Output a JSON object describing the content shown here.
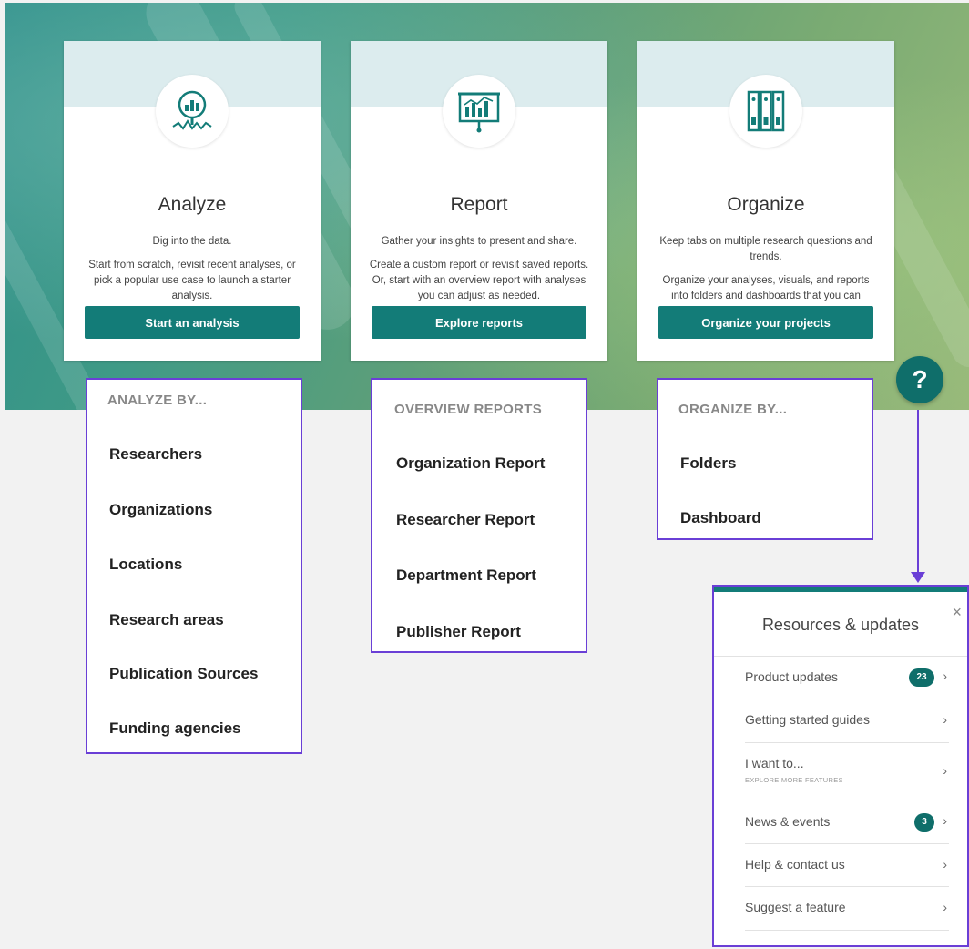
{
  "cards": [
    {
      "icon": "analyze-magnifier-chart-icon",
      "title": "Analyze",
      "desc1": "Dig into the data.",
      "desc2": "Start from scratch, revisit recent analyses, or pick a popular use case to launch a starter analysis.",
      "button": "Start an analysis"
    },
    {
      "icon": "report-presentation-board-icon",
      "title": "Report",
      "desc1": "Gather your insights to present and share.",
      "desc2": "Create a custom report or revisit saved reports. Or, start with an overview report with analyses you can adjust as needed.",
      "button": "Explore reports"
    },
    {
      "icon": "organize-binders-icon",
      "title": "Organize",
      "desc1": "Keep tabs on multiple research questions and trends.",
      "desc2": "Organize your analyses, visuals, and reports into folders and dashboards that you can revisit.",
      "button": "Organize your projects"
    }
  ],
  "help": {
    "label": "?",
    "icon": "help-question-icon"
  },
  "analyze_menu": {
    "header": "ANALYZE BY...",
    "items": [
      "Researchers",
      "Organizations",
      "Locations",
      "Research areas",
      "Publication Sources",
      "Funding agencies"
    ]
  },
  "report_menu": {
    "header": "OVERVIEW REPORTS",
    "items": [
      "Organization Report",
      "Researcher Report",
      "Department Report",
      "Publisher Report"
    ]
  },
  "organize_menu": {
    "header": "ORGANIZE BY...",
    "items": [
      "Folders",
      "Dashboard"
    ]
  },
  "panel": {
    "title": "Resources & updates",
    "close": "×",
    "rows": [
      {
        "label": "Product updates",
        "badge": "23"
      },
      {
        "label": "Getting started guides"
      },
      {
        "label": "I want to...",
        "sub": "EXPLORE MORE FEATURES"
      },
      {
        "label": "News & events",
        "badge": "3"
      },
      {
        "label": "Help & contact us"
      },
      {
        "label": "Suggest a feature"
      }
    ],
    "chevron": "›"
  },
  "colors": {
    "accent": "#137c78",
    "annotation": "#6a3fd6",
    "band": "#dcecee"
  }
}
